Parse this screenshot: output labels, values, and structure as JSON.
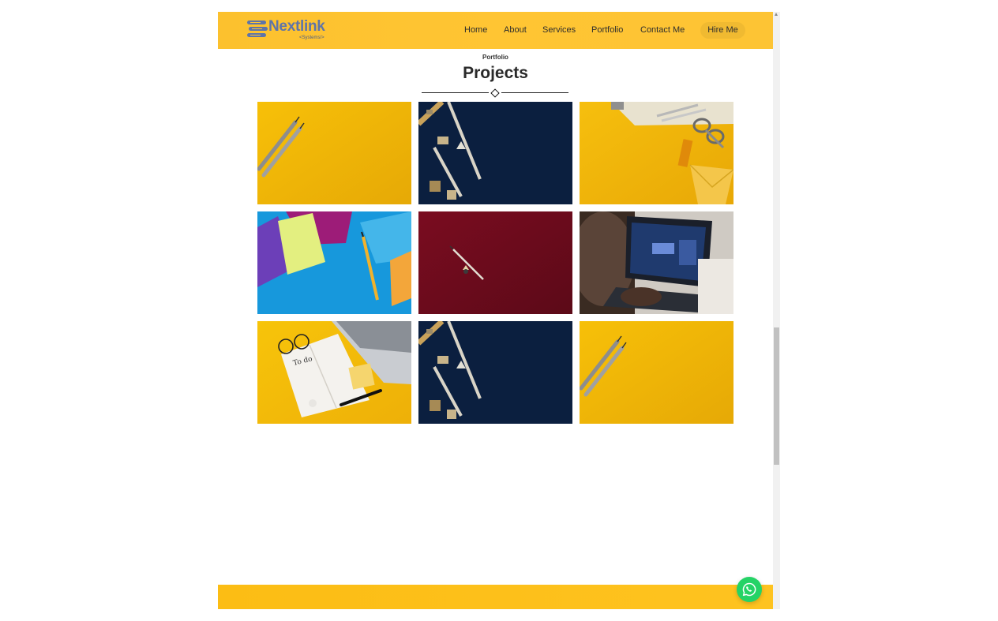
{
  "brand": {
    "name": "Nextlink",
    "tagline": "<Systems/>",
    "color": "#5e74a9"
  },
  "nav": {
    "items": [
      {
        "label": "Home"
      },
      {
        "label": "About"
      },
      {
        "label": "Services"
      },
      {
        "label": "Portfolio"
      },
      {
        "label": "Contact Me"
      }
    ],
    "cta_label": "Hire Me"
  },
  "section": {
    "eyebrow": "Portfolio",
    "title": "Projects"
  },
  "portfolio": {
    "items": [
      {
        "subject": "pencils-on-yellow"
      },
      {
        "subject": "stationery-on-navy"
      },
      {
        "subject": "scissors-envelope-on-yellow"
      },
      {
        "subject": "envelopes-on-blue"
      },
      {
        "subject": "pencil-on-maroon"
      },
      {
        "subject": "laptop-design"
      },
      {
        "subject": "notebook-laptop-on-yellow"
      },
      {
        "subject": "stationery-on-navy"
      },
      {
        "subject": "pencils-on-yellow"
      }
    ]
  },
  "colors": {
    "header": "#ffc533",
    "footer": "#fec320",
    "whatsapp": "#25d366"
  },
  "icons": {
    "chat": "whatsapp-icon",
    "logo": "server-stack-icon"
  }
}
